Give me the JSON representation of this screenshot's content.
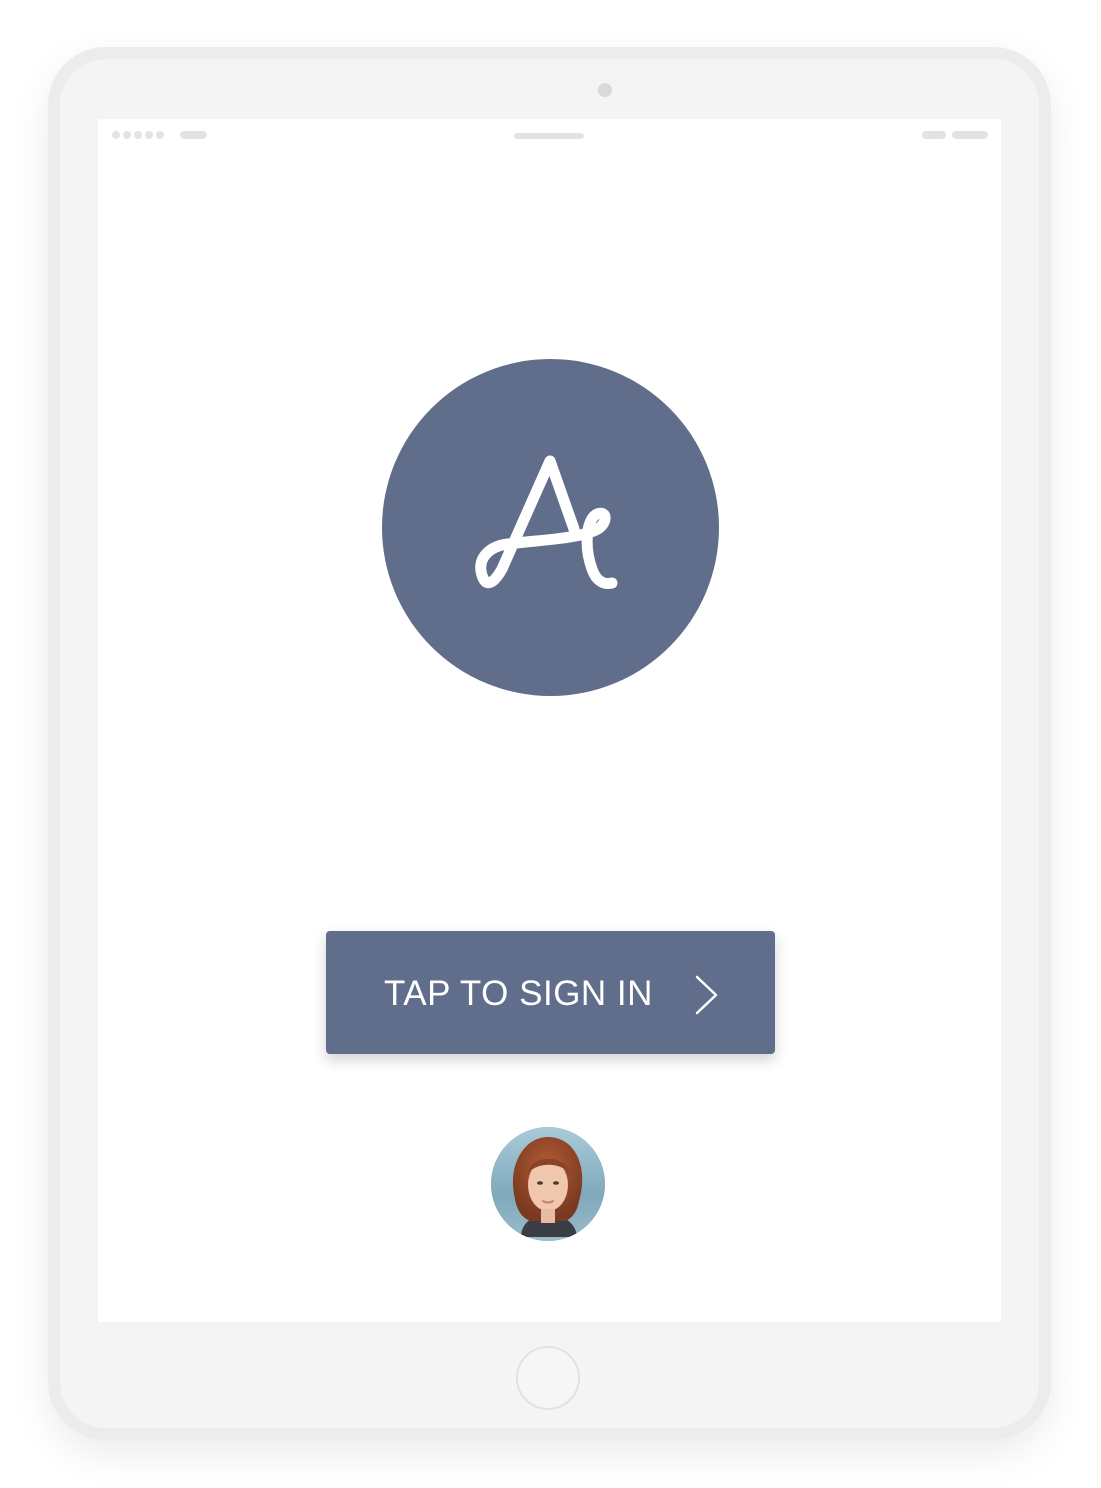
{
  "signin": {
    "label": "TAP TO SIGN IN"
  },
  "colors": {
    "accent": "#606d8b",
    "device_frame": "#ececec",
    "device_body": "#f4f4f4",
    "screen": "#ffffff"
  },
  "icons": {
    "logo": "cursive-letter-a-logo",
    "chevron": "chevron-right-icon",
    "avatar": "user-avatar-photo"
  }
}
